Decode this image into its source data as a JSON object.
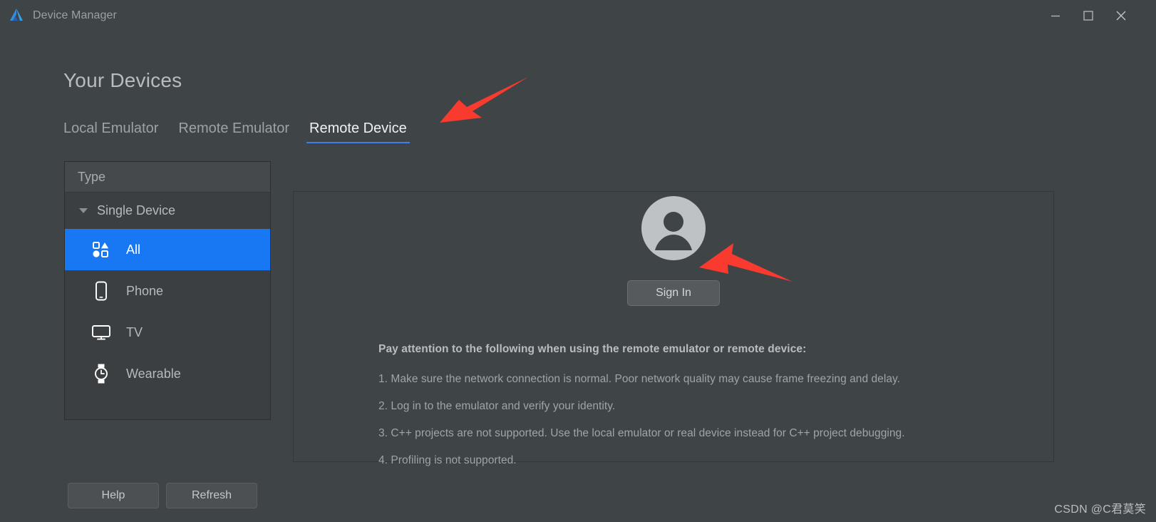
{
  "window": {
    "title": "Device Manager",
    "logo_icon": "deveco-logo-icon",
    "controls": {
      "minimize": "minimize-icon",
      "maximize": "maximize-icon",
      "close": "close-icon"
    }
  },
  "page": {
    "heading": "Your Devices"
  },
  "tabs": [
    {
      "label": "Local Emulator",
      "active": false
    },
    {
      "label": "Remote Emulator",
      "active": false
    },
    {
      "label": "Remote Device",
      "active": true
    }
  ],
  "device_list": {
    "column_header": "Type",
    "group": {
      "label": "Single Device",
      "expanded": true
    },
    "items": [
      {
        "label": "All",
        "icon": "shapes-grid-icon",
        "selected": true
      },
      {
        "label": "Phone",
        "icon": "phone-icon",
        "selected": false
      },
      {
        "label": "TV",
        "icon": "tv-monitor-icon",
        "selected": false
      },
      {
        "label": "Wearable",
        "icon": "watch-icon",
        "selected": false
      }
    ]
  },
  "footer_buttons": [
    {
      "label": "Help",
      "name": "help-button"
    },
    {
      "label": "Refresh",
      "name": "refresh-button"
    }
  ],
  "account": {
    "avatar_icon": "user-avatar-icon",
    "sign_in_label": "Sign In"
  },
  "notice": {
    "title": "Pay attention to the following when using the remote emulator or remote device:",
    "items": [
      "1. Make sure the network connection is normal. Poor network quality may cause frame freezing and delay.",
      "2. Log in to the emulator and verify your identity.",
      "3. C++ projects are not supported. Use the local emulator or real device instead for C++ project debugging.",
      "4. Profiling is not supported."
    ]
  },
  "annotations": {
    "arrow_color": "#f93a2f",
    "arrow_to_remote_device_tab": "red-arrow-icon",
    "arrow_to_sign_in_button": "red-arrow-icon"
  },
  "watermark": {
    "text": "CSDN @C君莫笑"
  },
  "colors": {
    "window_bg": "#3f4447",
    "panel_bg": "#3b3f42",
    "accent_selected": "#1877f2",
    "tab_underline": "#3f7ee8",
    "text_primary": "#b8bcbe",
    "text_muted": "#9fa4a8"
  }
}
